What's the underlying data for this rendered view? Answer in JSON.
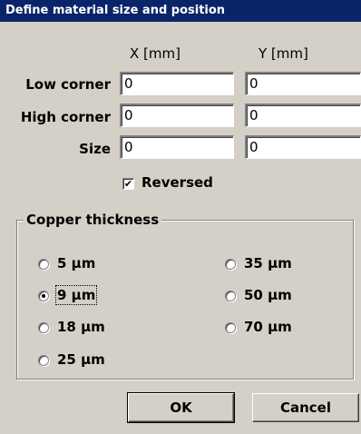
{
  "window": {
    "title": "Define material size and position"
  },
  "columns": {
    "x": "X [mm]",
    "y": "Y [mm]"
  },
  "rows": [
    {
      "label": "Low corner",
      "x": "0",
      "y": "0"
    },
    {
      "label": "High corner",
      "x": "0",
      "y": "0"
    },
    {
      "label": "Size",
      "x": "0",
      "y": "0"
    }
  ],
  "reversed": {
    "label": "Reversed",
    "checked": true
  },
  "copper": {
    "title": "Copper thickness",
    "options": [
      "5 µm",
      "9 µm",
      "18 µm",
      "25 µm",
      "35 µm",
      "50 µm",
      "70 µm"
    ],
    "selected": "9 µm"
  },
  "buttons": {
    "ok": "OK",
    "cancel": "Cancel"
  }
}
